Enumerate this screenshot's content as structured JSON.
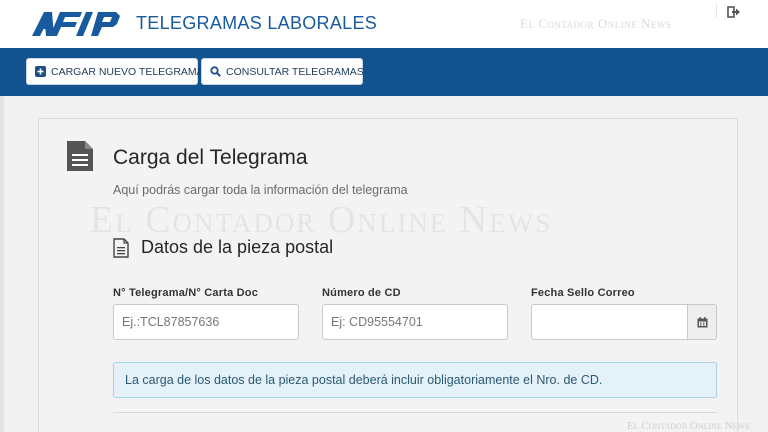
{
  "header": {
    "logo_text": "AFIP",
    "title": "TELEGRAMAS LABORALES",
    "watermark": "El Contador Online News",
    "logout_icon": "sign-out-icon"
  },
  "nav": {
    "buttons": [
      {
        "label": "CARGAR NUEVO TELEGRAMA",
        "icon": "plus-square-icon"
      },
      {
        "label": "CONSULTAR TELEGRAMAS",
        "icon": "search-icon"
      }
    ]
  },
  "main": {
    "title": "Carga del Telegrama",
    "subtitle": "Aquí podrás cargar toda la información del telegrama",
    "watermark": "El Contador Online News",
    "section": {
      "title": "Datos de la pieza postal",
      "fields": [
        {
          "label": "N° Telegrama/N° Carta Doc",
          "placeholder": "Ej.:TCL87857636",
          "value": ""
        },
        {
          "label": "Número de CD",
          "placeholder": "Ej: CD95554701",
          "value": ""
        },
        {
          "label": "Fecha Sello Correo",
          "placeholder": "",
          "value": "",
          "icon": "calendar-icon"
        }
      ],
      "alert": "La carga de los datos de la pieza postal deberá incluir obligatoriamente el Nro. de CD."
    },
    "footer_watermark": "El Contador Online News"
  },
  "colors": {
    "brand_blue": "#12528f",
    "title_blue": "#175a9f",
    "alert_bg": "#e4f1f8",
    "alert_border": "#a9d2e6"
  }
}
